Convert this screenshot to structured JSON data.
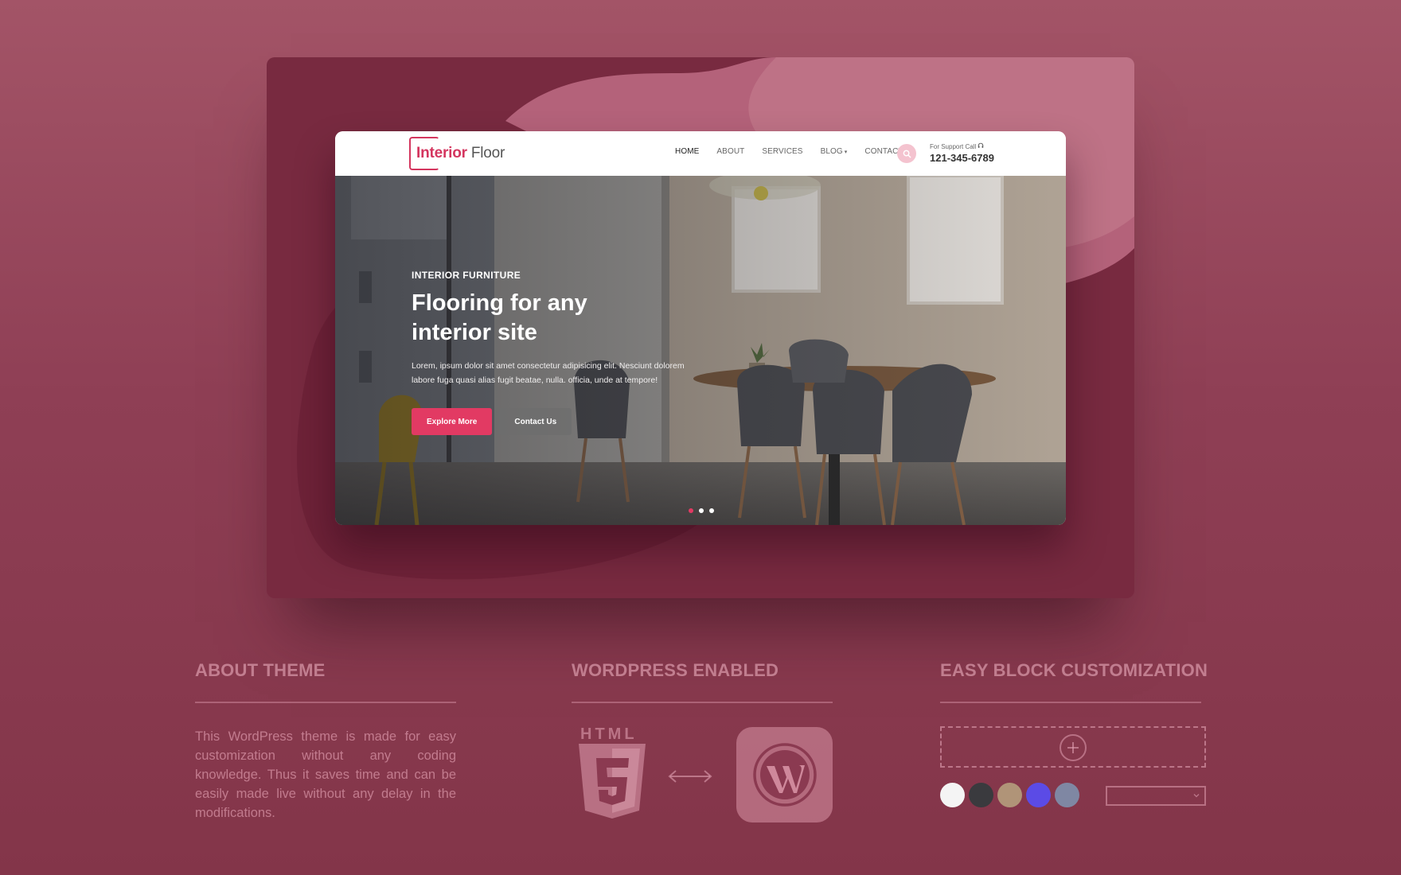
{
  "site": {
    "logo": {
      "part1": "Interior",
      "part2": "Floor"
    },
    "nav": [
      {
        "label": "HOME",
        "active": true
      },
      {
        "label": "ABOUT",
        "active": false
      },
      {
        "label": "SERVICES",
        "active": false
      },
      {
        "label": "BLOG",
        "active": false,
        "has_dropdown": true
      },
      {
        "label": "CONTACT",
        "active": false
      }
    ],
    "search_icon": "search-icon",
    "support": {
      "label": "For Support Call",
      "icon": "headset-icon",
      "phone": "121-345-6789"
    },
    "hero": {
      "kicker": "INTERIOR FURNITURE",
      "title": "Flooring for any interior site",
      "description": "Lorem, ipsum dolor sit amet consectetur adipisicing elit. Nesciunt dolorem labore fuga quasi alias fugit beatae, nulla. officia, unde at tempore!",
      "primary_button": "Explore More",
      "secondary_button": "Contact Us",
      "slides_total": 3,
      "slide_active": 1
    },
    "accent_color": "#e23a63"
  },
  "features": [
    {
      "heading": "ABOUT THEME",
      "text": "This WordPress theme is made for easy customization without any coding knowledge. Thus it saves time and can be easily made live without any delay in the modifications."
    },
    {
      "heading": "WORDPRESS ENABLED",
      "html5_label": "HTML",
      "icons": [
        "html5-icon",
        "double-arrow-icon",
        "wordpress-icon"
      ]
    },
    {
      "heading": "EASY BLOCK CUSTOMIZATION",
      "icons": [
        "plus-icon",
        "chevron-down-icon"
      ],
      "swatches": [
        "#f4f4f4",
        "#3a3a3e",
        "#b09478",
        "#5b4be6",
        "#7f87a3"
      ]
    }
  ]
}
